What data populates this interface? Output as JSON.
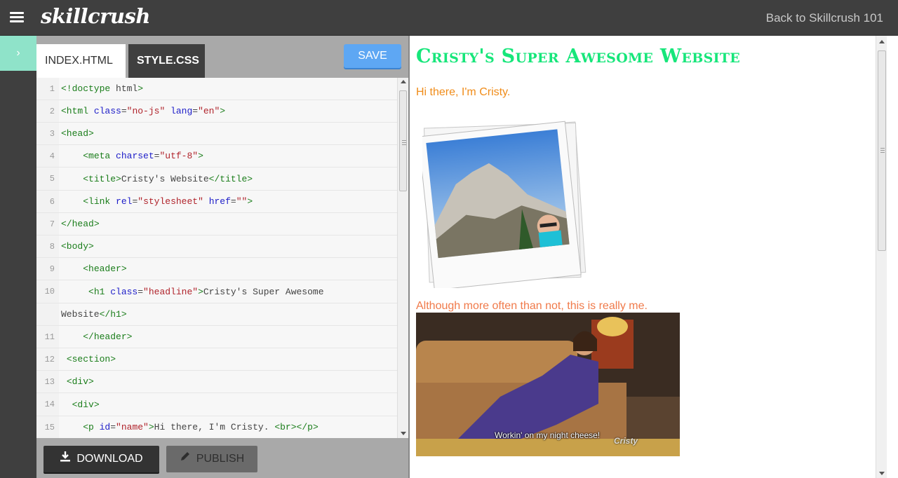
{
  "topbar": {
    "logo": "skillcrush",
    "back_link": "Back to Skillcrush 101"
  },
  "rail": {
    "toggle_glyph": "›"
  },
  "editor": {
    "tabs": [
      {
        "label": "INDEX.HTML",
        "active": true
      },
      {
        "label": "STYLE.CSS",
        "active": false
      }
    ],
    "save_label": "SAVE",
    "download_label": "DOWNLOAD",
    "publish_label": "PUBLISH",
    "code_lines": [
      {
        "n": "1",
        "text": "<!doctype html>"
      },
      {
        "n": "2",
        "text": "<html class=\"no-js\" lang=\"en\">"
      },
      {
        "n": "3",
        "text": "<head>"
      },
      {
        "n": "4",
        "text": "    <meta charset=\"utf-8\">"
      },
      {
        "n": "5",
        "text": "    <title>Cristy's Website</title>"
      },
      {
        "n": "6",
        "text": "    <link rel=\"stylesheet\" href=\"\">"
      },
      {
        "n": "7",
        "text": "</head>"
      },
      {
        "n": "8",
        "text": "<body>"
      },
      {
        "n": "9",
        "text": "    <header>"
      },
      {
        "n": "10",
        "text": "     <h1 class=\"headline\">Cristy's Super Awesome"
      },
      {
        "n": "",
        "text": "Website</h1>"
      },
      {
        "n": "11",
        "text": "    </header>"
      },
      {
        "n": "12",
        "text": " <section>"
      },
      {
        "n": "13",
        "text": " <div>"
      },
      {
        "n": "14",
        "text": "  <div>"
      },
      {
        "n": "15",
        "text": "    <p id=\"name\">Hi there, I'm Cristy. <br></p>"
      }
    ]
  },
  "preview": {
    "headline": "Cristy's Super Awesome Website",
    "greeting": "Hi there, I'm Cristy.",
    "caption": "Although more often than not, this is really me.",
    "gif_subtitle": "Workin' on my night cheese!",
    "gif_watermark": "Cristy",
    "colors": {
      "headline": "#16e67a",
      "greeting": "#f08c19",
      "caption": "#f07a4a"
    }
  }
}
